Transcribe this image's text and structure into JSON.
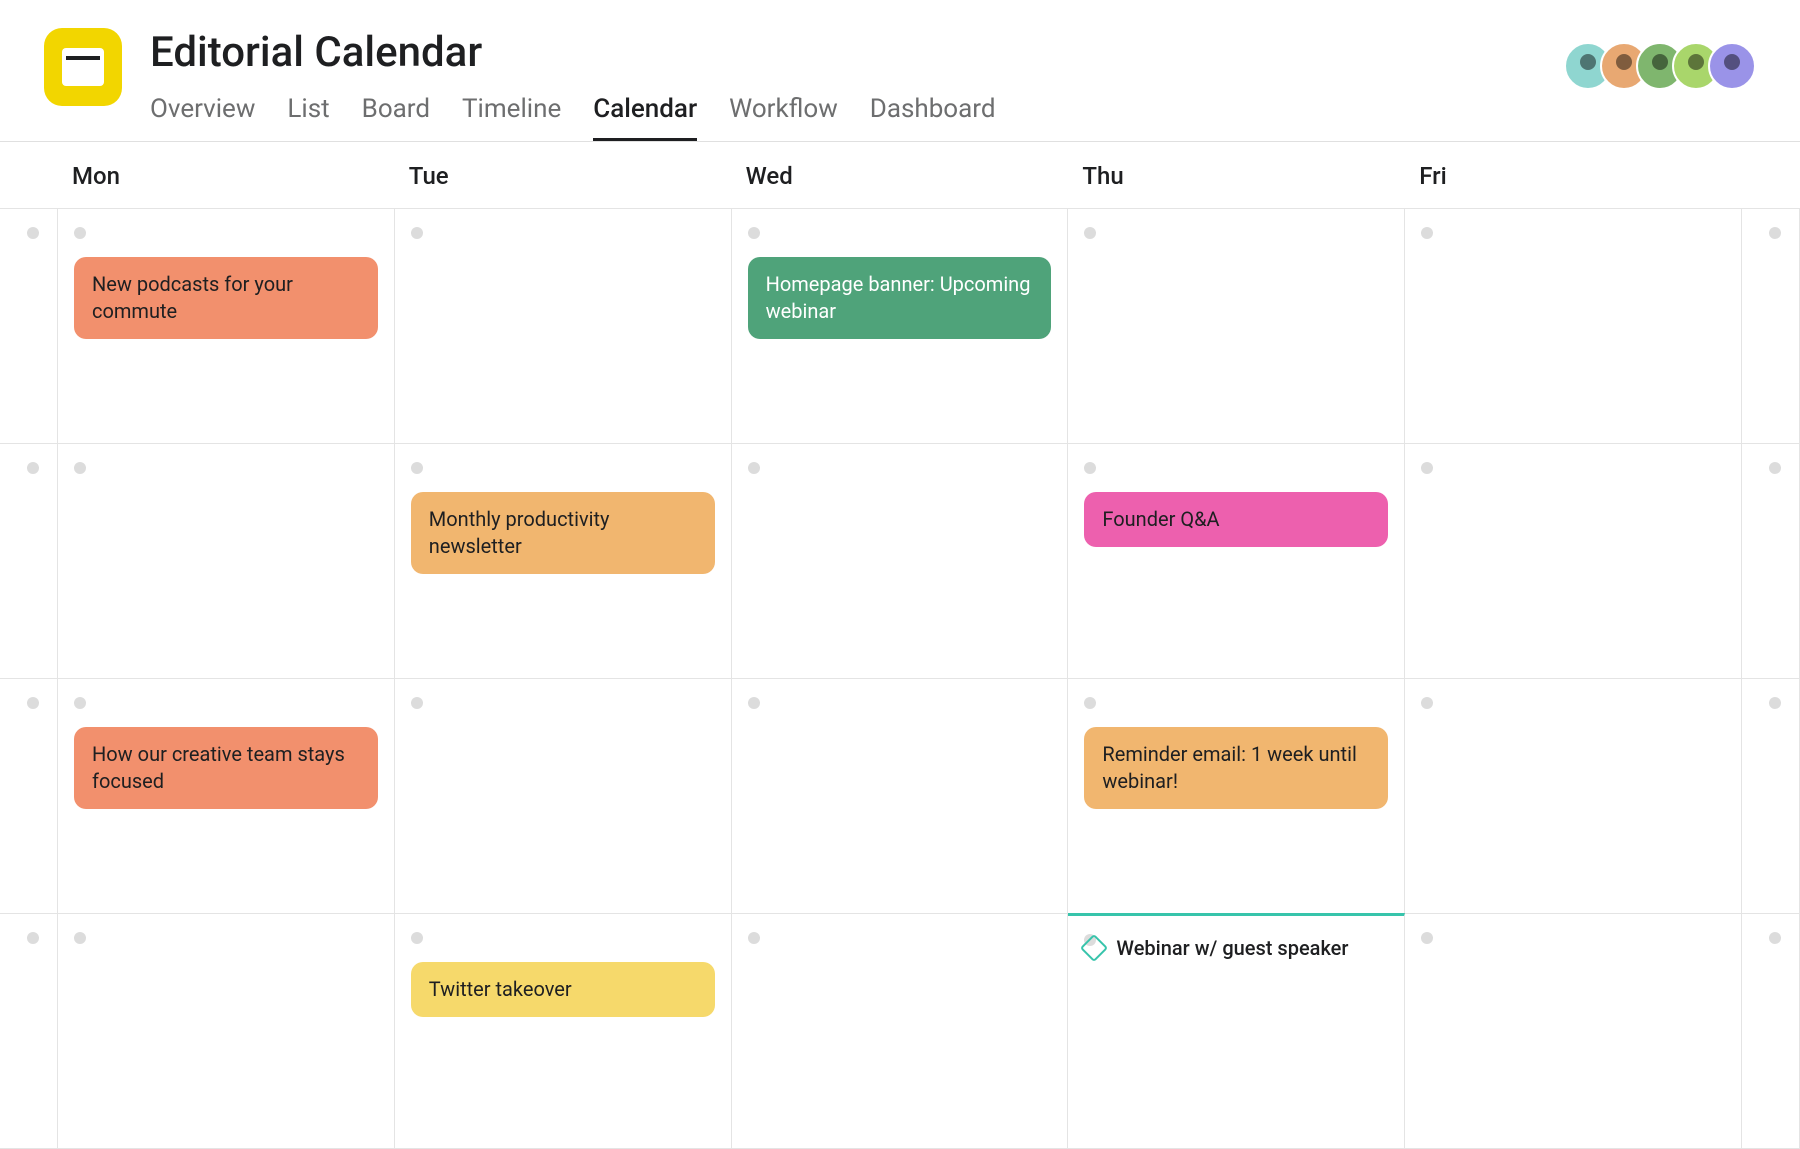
{
  "project": {
    "title": "Editorial Calendar"
  },
  "tabs": {
    "overview": "Overview",
    "list": "List",
    "board": "Board",
    "timeline": "Timeline",
    "calendar": "Calendar",
    "workflow": "Workflow",
    "dashboard": "Dashboard"
  },
  "weekdays": {
    "mon": "Mon",
    "tue": "Tue",
    "wed": "Wed",
    "thu": "Thu",
    "fri": "Fri"
  },
  "avatars": [
    {
      "bg": "#8fd6d0"
    },
    {
      "bg": "#e8a872"
    },
    {
      "bg": "#7fb66e"
    },
    {
      "bg": "#a9d66b"
    },
    {
      "bg": "#9a93e8"
    }
  ],
  "events": {
    "w1_mon": "New podcasts for your commute",
    "w1_wed": "Homepage banner: Upcoming webinar",
    "w2_tue": "Monthly productivity newsletter",
    "w2_thu": "Founder Q&A",
    "w3_mon": "How our creative team stays focused",
    "w3_thu": "Reminder email: 1 week until webinar!",
    "w4_tue": "Twitter takeover",
    "w4_thu": "Webinar w/ guest speaker"
  },
  "colors": {
    "coral": "#f2906d",
    "green": "#4fa37a",
    "amber": "#f1b66f",
    "pink": "#ed60ae",
    "yellow": "#f6d96b"
  }
}
